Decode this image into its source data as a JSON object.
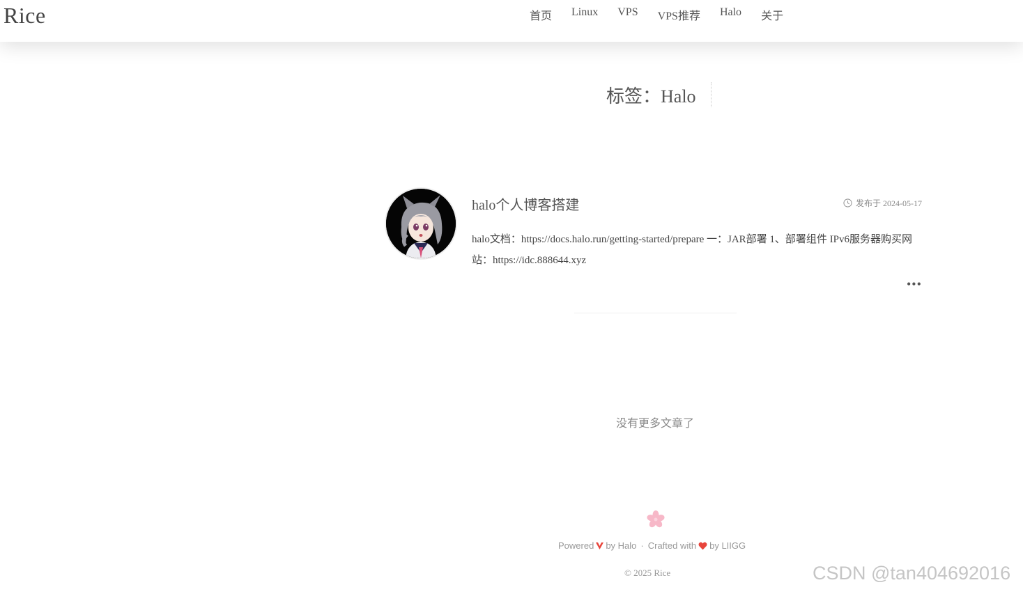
{
  "site": {
    "logo": "Rice"
  },
  "nav": {
    "items": [
      "首页",
      "Linux",
      "VPS",
      "VPS推荐",
      "Halo",
      "关于"
    ]
  },
  "tag_page": {
    "title": "标签：Halo"
  },
  "post": {
    "title": "halo个人博客搭建",
    "date": "发布于 2024-05-17",
    "excerpt": "halo文档：https://docs.halo.run/getting-started/prepare 一：JAR部署 1、部署组件 IPv6服务器购买网站：https://idc.888644.xyz",
    "more": "•••"
  },
  "pagination": {
    "no_more": "没有更多文章了"
  },
  "footer": {
    "powered": "Powered",
    "by_halo": "by Halo",
    "crafted": "Crafted with",
    "by_liigg": "by LIIGG",
    "separator": "·",
    "copyright": "© 2025 Rice"
  },
  "watermark": "CSDN @tan404692016",
  "colors": {
    "accent_red": "#e8453c",
    "sakura_pink": "#f7b8c8"
  }
}
